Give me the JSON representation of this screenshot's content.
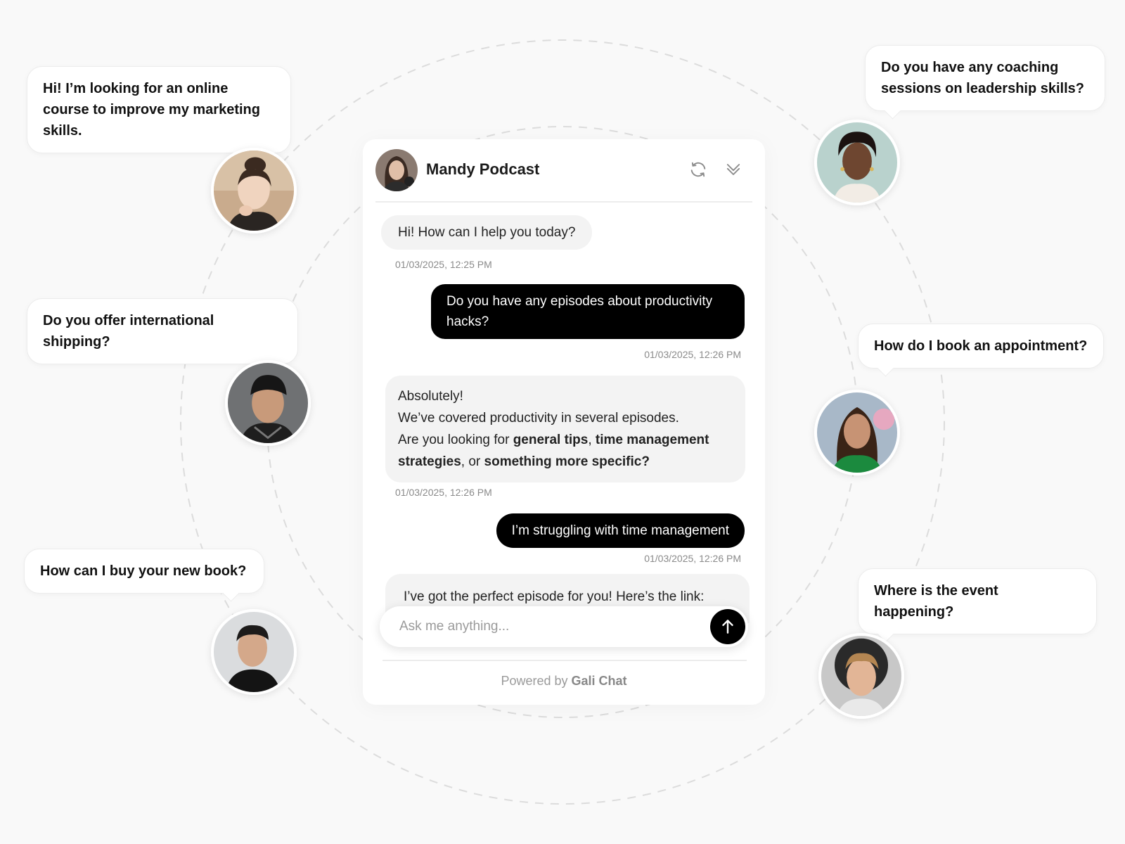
{
  "widget": {
    "title": "Mandy Podcast",
    "refresh_icon": "refresh-icon",
    "collapse_icon": "double-chevron-down-icon",
    "messages": [
      {
        "from": "bot",
        "text": "Hi! How can I help you today?",
        "time": "01/03/2025, 12:25 PM"
      },
      {
        "from": "user",
        "text": "Do you have any episodes about productivity hacks?",
        "time": "01/03/2025, 12:26 PM"
      },
      {
        "from": "bot",
        "line1": "Absolutely!",
        "line2": "We’ve covered productivity in several episodes.",
        "line3_prefix": "Are you looking for ",
        "bold1": "general tips",
        "sep1": ", ",
        "bold2": "time management strategies",
        "sep2": ", or ",
        "bold3": "something more specific?",
        "time": "01/03/2025, 12:26 PM"
      },
      {
        "from": "user",
        "text": "I’m struggling with time management",
        "time": "01/03/2025, 12:26 PM"
      },
      {
        "from": "bot",
        "text": "I’ve got the perfect episode for you! Here’s the link:"
      }
    ],
    "input_placeholder": "Ask me anything...",
    "send_icon": "arrow-up-icon",
    "powered_prefix": "Powered by ",
    "powered_brand": "Gali Chat"
  },
  "side_questions": {
    "q1": "Hi! I’m looking for an online course to improve my marketing skills.",
    "q2": "Do you offer international shipping?",
    "q3": "How can I buy your new book?",
    "q4": "Do you have any coaching sessions on leadership skills?",
    "q5": "How do I book an appointment?",
    "q6": "Where is the event happening?"
  },
  "colors": {
    "background": "#f9f9f9",
    "user_bubble": "#000000",
    "bot_bubble": "#f3f3f3",
    "ring": "#dcdcdc"
  }
}
